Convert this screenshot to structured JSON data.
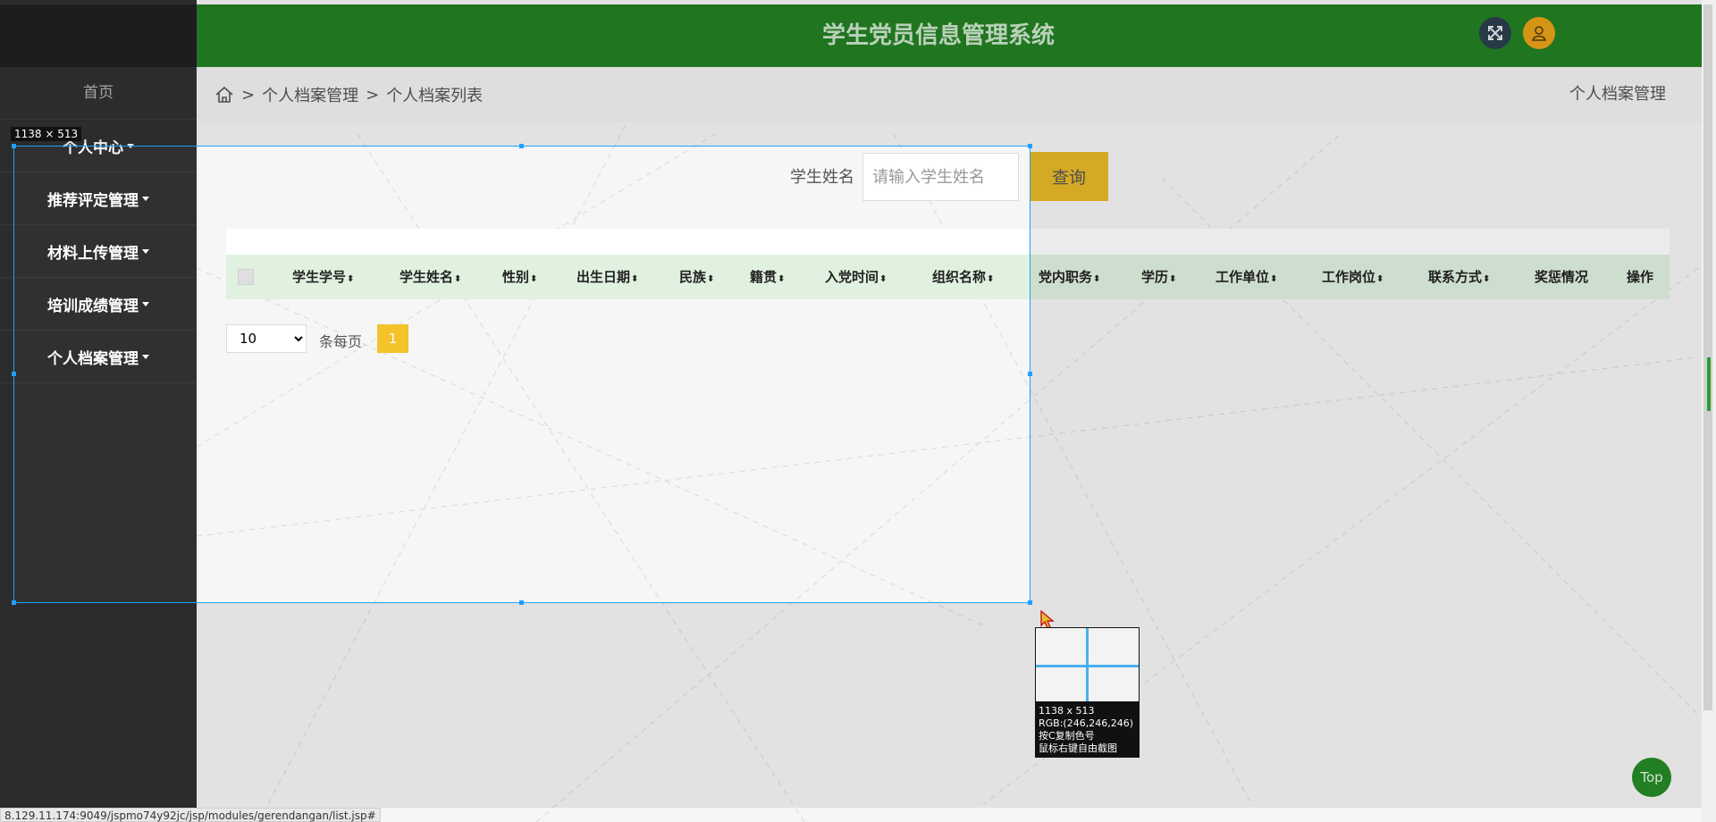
{
  "header": {
    "title": "学生党员信息管理系统",
    "fullscreen_icon": "expand-icon",
    "user_icon": "user-icon"
  },
  "sidebar": {
    "home": "首页",
    "items": [
      {
        "label": "个人中心"
      },
      {
        "label": "推荐评定管理"
      },
      {
        "label": "材料上传管理"
      },
      {
        "label": "培训成绩管理"
      },
      {
        "label": "个人档案管理"
      }
    ]
  },
  "breadcrumb": {
    "home_icon": "home-icon",
    "sep": ">",
    "items": [
      "个人档案管理",
      "个人档案列表"
    ],
    "right": "个人档案管理"
  },
  "search": {
    "label": "学生姓名",
    "placeholder": "请输入学生姓名",
    "button": "查询"
  },
  "table": {
    "columns": [
      "学生学号",
      "学生姓名",
      "性别",
      "出生日期",
      "民族",
      "籍贯",
      "入党时间",
      "组织名称",
      "党内职务",
      "学历",
      "工作单位",
      "工作岗位",
      "联系方式",
      "奖惩情况",
      "操作"
    ],
    "sortable": [
      true,
      true,
      true,
      true,
      true,
      true,
      true,
      true,
      true,
      true,
      true,
      true,
      true,
      false,
      false
    ]
  },
  "pager": {
    "page_size": "10",
    "page_size_options": [
      "10"
    ],
    "per_page_label": "条每页",
    "current_page": "1"
  },
  "overlay": {
    "selection_size": "1138 × 513",
    "magnifier_lines": [
      "1138 x 513",
      "RGB:(246,246,246)",
      "按C复制色号",
      "鼠标右键自由截图"
    ]
  },
  "top_button": "Top",
  "status_url": "8.129.11.174:9049/jspmo74y92jc/jsp/modules/gerendangan/list.jsp#",
  "colors": {
    "header": "#237f23",
    "sidebar": "#303030",
    "accent": "#e6b929",
    "table_header": "#e0f1e0",
    "selection": "#1ea0ff"
  }
}
